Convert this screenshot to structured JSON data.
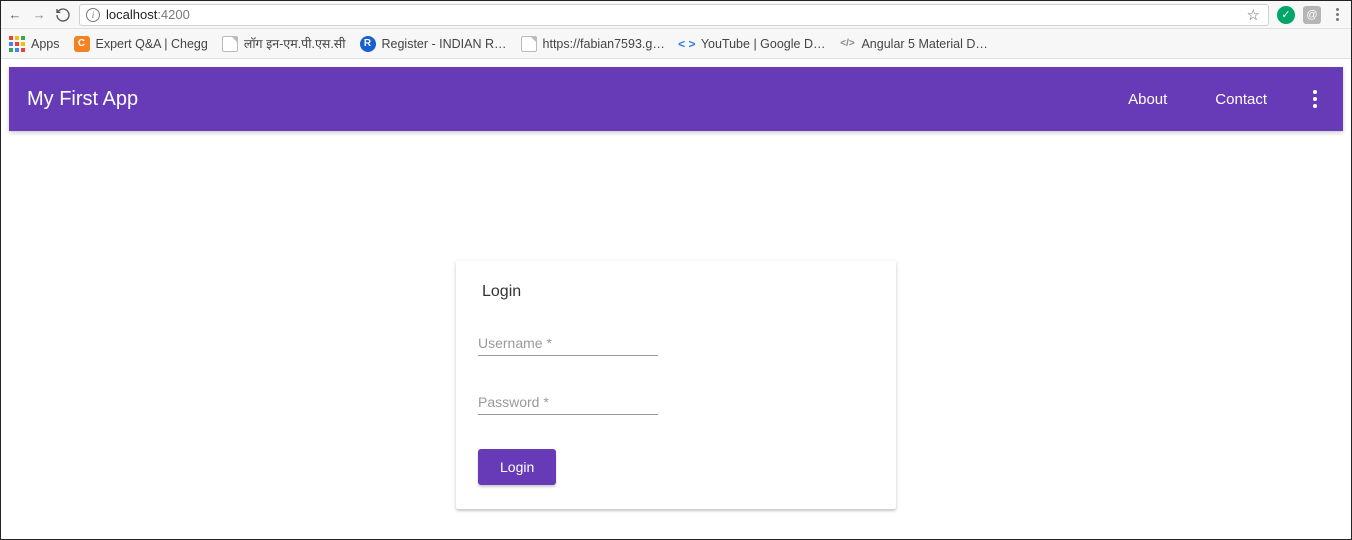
{
  "browser": {
    "url_host": "localhost",
    "url_port": ":4200",
    "bookmarks": {
      "apps": "Apps",
      "items": [
        "Expert Q&A | Chegg",
        "लॉग इन-एम.पी.एस.सी",
        "Register - INDIAN R…",
        "https://fabian7593.g…",
        "YouTube  |  Google D…",
        "Angular 5 Material D…"
      ]
    }
  },
  "app": {
    "title": "My First App",
    "nav": {
      "about": "About",
      "contact": "Contact"
    }
  },
  "login": {
    "title": "Login",
    "username_placeholder": "Username *",
    "password_placeholder": "Password *",
    "button_label": "Login"
  }
}
